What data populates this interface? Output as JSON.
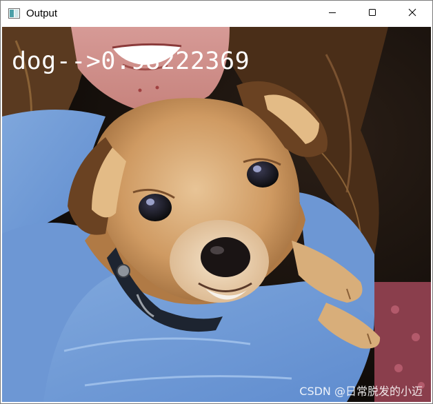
{
  "window": {
    "title": "Output",
    "app_icon": "opencv-window-icon",
    "controls": {
      "minimize_icon": "minimize-icon",
      "maximize_icon": "maximize-icon",
      "close_icon": "close-icon"
    }
  },
  "image": {
    "subject": "puppy held by girl",
    "overlay_text": "dog-->0.98222369"
  },
  "watermark": {
    "text": "CSDN @日常脱发的小迈"
  }
}
